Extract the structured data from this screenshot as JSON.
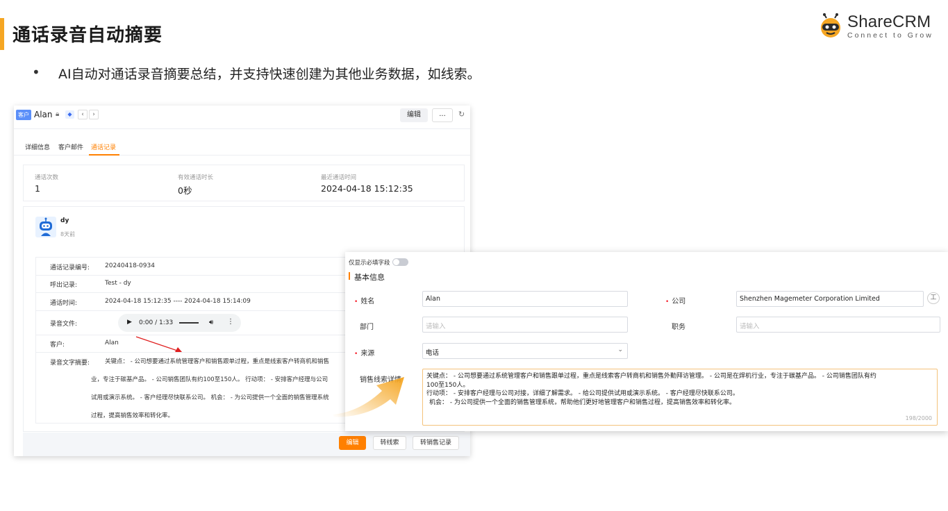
{
  "slide": {
    "title": "通话录音自动摘要",
    "bullet": "AI自动对通话录音摘要总结，并支持快速创建为其他业务数据，如线索。"
  },
  "logo": {
    "name": "ShareCRM",
    "tagline": "Connect to Grow",
    "accent_color": "#f5a623"
  },
  "customer_panel": {
    "tag": "客户",
    "name": "Alan",
    "edit_label": "编辑",
    "more_label": "...",
    "tabs": [
      "详细信息",
      "客户邮件",
      "通话记录"
    ],
    "active_tab": "通话记录",
    "stats": [
      {
        "label": "通话次数",
        "value": "1"
      },
      {
        "label": "有效通话时长",
        "value": "0秒"
      },
      {
        "label": "最近通话时间",
        "value": "2024-04-18 15:12:35"
      }
    ],
    "record": {
      "user": "dy",
      "time_ago": "8天前",
      "fields": [
        {
          "label": "通话记录编号:",
          "value": "20240418-0934"
        },
        {
          "label": "呼出记录:",
          "value": "Test - dy"
        },
        {
          "label": "通话时间:",
          "value": "2024-04-18 15:12:35 ---- 2024-04-18 15:14:09"
        },
        {
          "label": "录音文件:",
          "value": ""
        },
        {
          "label": "客户:",
          "value": "Alan"
        },
        {
          "label": "录音文字摘要:",
          "value": ""
        }
      ],
      "audio_time": "0:00 / 1:33",
      "audio_progress": 0,
      "summary_lines": [
        "关键点： - 公司想要通过系统管理客户和销售跟单过程，重点是线索客户转商机和销售",
        "业，专注于碳基产品。 - 公司销售团队有约100至150人。 行动项： - 安排客户经理与公司",
        "试用或演示系统。 - 客户经理尽快联系公司。 机会： - 为公司提供一个全面的销售管理系统",
        "过程，提高销售效率和转化率。"
      ]
    },
    "footer_buttons": [
      "编辑",
      "转线索",
      "转销售记录"
    ]
  },
  "lead_form": {
    "toggle_label": "仅显示必填字段",
    "toggle_on": false,
    "section_title": "基本信息",
    "fields": {
      "name": {
        "label": "姓名",
        "value": "Alan",
        "required": true
      },
      "company": {
        "label": "公司",
        "value": "Shenzhen Magemeter Corporation Limited",
        "required": true
      },
      "department": {
        "label": "部门",
        "placeholder": "请输入"
      },
      "position": {
        "label": "职务",
        "placeholder": "请输入"
      },
      "source": {
        "label": "来源",
        "value": "电话",
        "required": true
      },
      "details": {
        "label": "销售线索详情",
        "lines": [
          "关键点： - 公司想要通过系统管理客户和销售跟单过程，重点是线索客户转商机和销售外勤拜访管理。 - 公司是在焊机行业，专注于碳基产品。 - 公司销售团队有约",
          "100至150人。",
          "行动项： - 安排客户经理与公司对接，详细了解需求。 - 给公司提供试用或演示系统。 - 客户经理尽快联系公司。",
          "机会： - 为公司提供一个全面的销售管理系统，帮助他们更好地管理客户和销售过程，提高销售效率和转化率。"
        ],
        "counter": "198/2000"
      }
    }
  }
}
